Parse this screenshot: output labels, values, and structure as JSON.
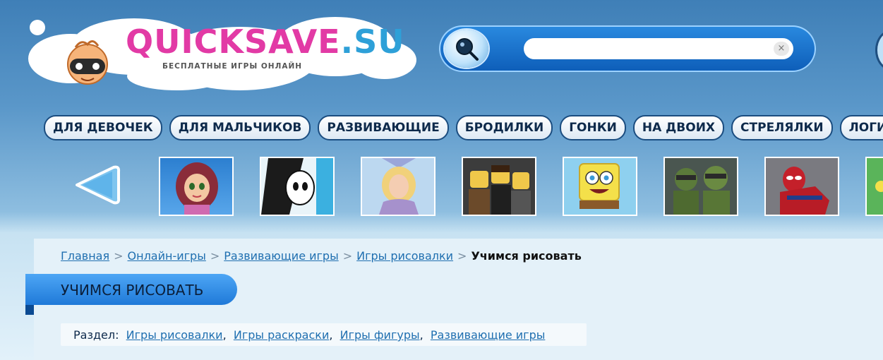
{
  "logo": {
    "title_main": "QUICKSAVE",
    "title_suffix": ".SU",
    "subtitle": "БЕСПЛАТНЫЕ ИГРЫ ОНЛАЙН"
  },
  "search": {
    "value": "",
    "placeholder": "",
    "clear_glyph": "×",
    "button_icon": "search-icon"
  },
  "nav": [
    "ДЛЯ ДЕВОЧЕК",
    "ДЛЯ МАЛЬЧИКОВ",
    "РАЗВИВАЮЩИЕ",
    "БРОДИЛКИ",
    "ГОНКИ",
    "НА ДВОИХ",
    "СТРЕЛЯЛКИ",
    "ЛОГИЧЕСКИ"
  ],
  "carousel": {
    "prev_icon": "arrow-left-icon",
    "thumbs": [
      "winx",
      "monster-high",
      "barbie",
      "lego",
      "spongebob",
      "turtles",
      "spiderman",
      "green"
    ]
  },
  "breadcrumb": {
    "items": [
      "Главная",
      "Онлайн-игры",
      "Развивающие игры",
      "Игры рисовалки"
    ],
    "separator": ">",
    "current": "Учимся рисовать"
  },
  "page_title": "УЧИМСЯ РИСОВАТЬ",
  "section": {
    "label": "Раздел:",
    "links": [
      "Игры рисовалки",
      "Игры раскраски",
      "Игры фигуры",
      "Развивающие игры"
    ]
  },
  "colors": {
    "accent": "#1f79d8",
    "link": "#1f6fb0",
    "nav_border": "#1b4d80",
    "logo_pink": "#e23aa5"
  }
}
